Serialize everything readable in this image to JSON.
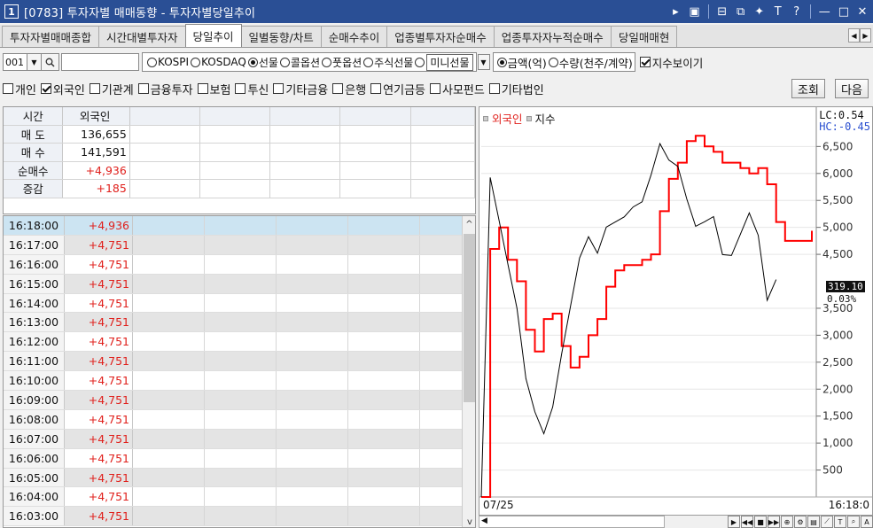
{
  "window": {
    "number": "1",
    "title": "[0783] 투자자별 매매동향 - 투자자별당일추이"
  },
  "tabs": [
    {
      "label": "투자자별매매종합",
      "active": false
    },
    {
      "label": "시간대별투자자",
      "active": false
    },
    {
      "label": "당일추이",
      "active": true
    },
    {
      "label": "일별동향/차트",
      "active": false
    },
    {
      "label": "순매수추이",
      "active": false
    },
    {
      "label": "업종별투자자순매수",
      "active": false
    },
    {
      "label": "업종투자자누적순매수",
      "active": false
    },
    {
      "label": "당일매매현",
      "active": false
    }
  ],
  "options": {
    "code": "001",
    "markets": [
      {
        "label": "KOSPI",
        "selected": false
      },
      {
        "label": "KOSDAQ",
        "selected": false
      },
      {
        "label": "선물",
        "selected": true
      },
      {
        "label": "콜옵션",
        "selected": false
      },
      {
        "label": "풋옵션",
        "selected": false
      },
      {
        "label": "주식선물",
        "selected": false
      },
      {
        "label": "미니선물",
        "selected": false
      }
    ],
    "units": [
      {
        "label": "금액(억)",
        "selected": true
      },
      {
        "label": "수량(천주/계약)",
        "selected": false
      }
    ],
    "show_index": {
      "label": "지수보이기",
      "checked": true
    }
  },
  "investors": [
    {
      "label": "개인",
      "checked": false
    },
    {
      "label": "외국인",
      "checked": true
    },
    {
      "label": "기관계",
      "checked": false
    },
    {
      "label": "금융투자",
      "checked": false
    },
    {
      "label": "보험",
      "checked": false
    },
    {
      "label": "투신",
      "checked": false
    },
    {
      "label": "기타금융",
      "checked": false
    },
    {
      "label": "은행",
      "checked": false
    },
    {
      "label": "연기금등",
      "checked": false
    },
    {
      "label": "사모펀드",
      "checked": false
    },
    {
      "label": "기타법인",
      "checked": false
    }
  ],
  "buttons": {
    "inquiry": "조회",
    "next": "다음"
  },
  "summary": {
    "header": {
      "label": "시간",
      "col": "외국인"
    },
    "rows": [
      {
        "label": "매 도",
        "value": "136,655",
        "red": false
      },
      {
        "label": "매 수",
        "value": "141,591",
        "red": false
      },
      {
        "label": "순매수",
        "value": "+4,936",
        "red": true
      },
      {
        "label": "증감",
        "value": "+185",
        "red": true
      }
    ]
  },
  "timeseries": [
    {
      "time": "16:18:00",
      "value": "+4,936"
    },
    {
      "time": "16:17:00",
      "value": "+4,751"
    },
    {
      "time": "16:16:00",
      "value": "+4,751"
    },
    {
      "time": "16:15:00",
      "value": "+4,751"
    },
    {
      "time": "16:14:00",
      "value": "+4,751"
    },
    {
      "time": "16:13:00",
      "value": "+4,751"
    },
    {
      "time": "16:12:00",
      "value": "+4,751"
    },
    {
      "time": "16:11:00",
      "value": "+4,751"
    },
    {
      "time": "16:10:00",
      "value": "+4,751"
    },
    {
      "time": "16:09:00",
      "value": "+4,751"
    },
    {
      "time": "16:08:00",
      "value": "+4,751"
    },
    {
      "time": "16:07:00",
      "value": "+4,751"
    },
    {
      "time": "16:06:00",
      "value": "+4,751"
    },
    {
      "time": "16:05:00",
      "value": "+4,751"
    },
    {
      "time": "16:04:00",
      "value": "+4,751"
    },
    {
      "time": "16:03:00",
      "value": "+4,751"
    }
  ],
  "chart": {
    "legend": [
      "외국인",
      "지수"
    ],
    "lc": "LC:0.54",
    "hc": "HC:-0.45",
    "y_ticks": [
      "6,500",
      "6,000",
      "5,500",
      "5,000",
      "4,500",
      "3,500",
      "3,000",
      "2,500",
      "2,000",
      "1,500",
      "1,000",
      "500"
    ],
    "current_index": "319.10",
    "current_pct": "0.03%",
    "date": "07/25",
    "time": "16:18:0"
  },
  "chart_data": {
    "type": "line",
    "ylim": [
      0,
      6900
    ],
    "series": [
      {
        "name": "외국인",
        "color": "#ff0000",
        "values": [
          0,
          4600,
          5000,
          4400,
          4000,
          3100,
          2700,
          3300,
          3400,
          2800,
          2400,
          2600,
          3000,
          3300,
          3900,
          4200,
          4300,
          4300,
          4400,
          4500,
          5300,
          5900,
          6200,
          6600,
          6700,
          6500,
          6400,
          6200,
          6200,
          6100,
          6000,
          6100,
          5800,
          5100,
          4750,
          4750,
          4750,
          4936
        ]
      },
      {
        "name": "지수",
        "color": "#000000",
        "values": [
          -900,
          5900,
          5200,
          4200,
          3500,
          2300,
          1500,
          1200,
          1800,
          2600,
          3600,
          4300,
          4800,
          4600,
          4900,
          5100,
          5300,
          5300,
          5500,
          6100,
          6500,
          6300,
          6000,
          5500,
          5100,
          5000,
          5200,
          4600,
          4400,
          4900,
          5400,
          4800,
          3700,
          3900,
          null,
          null,
          null,
          null
        ]
      }
    ]
  }
}
